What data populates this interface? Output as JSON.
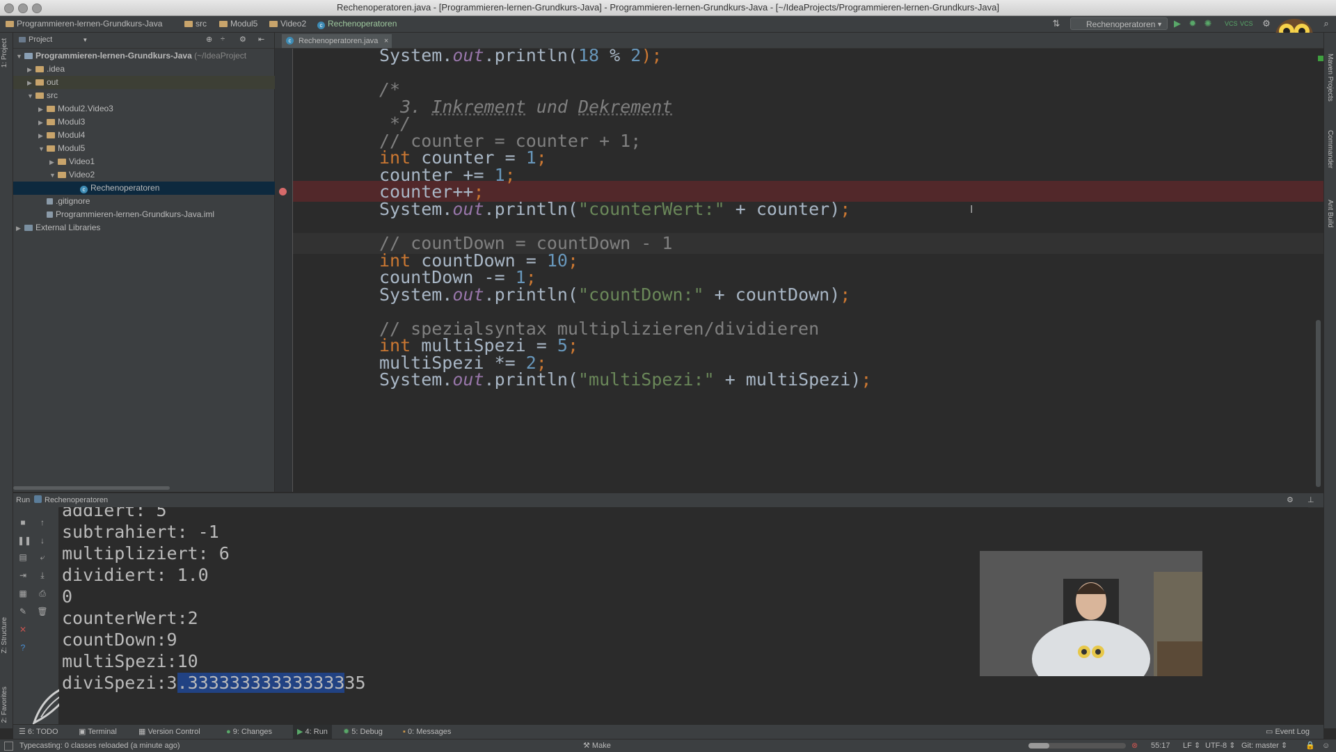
{
  "window": {
    "title": "Rechenoperatoren.java - [Programmieren-lernen-Grundkurs-Java] - Programmieren-lernen-Grundkurs-Java - [~/IdeaProjects/Programmieren-lernen-Grundkurs-Java]"
  },
  "breadcrumbs": [
    "Programmieren-lernen-Grundkurs-Java",
    "src",
    "Modul5",
    "Video2",
    "Rechenoperatoren"
  ],
  "run_config": {
    "selected": "Rechenoperatoren"
  },
  "project_panel": {
    "title": "Project",
    "tree": [
      {
        "label": "Programmieren-lernen-Grundkurs-Java",
        "suffix": "(~/IdeaProject",
        "depth": 0,
        "expanded": true,
        "kind": "module"
      },
      {
        "label": ".idea",
        "depth": 1,
        "expanded": false,
        "kind": "folder"
      },
      {
        "label": "out",
        "depth": 1,
        "expanded": false,
        "kind": "folder"
      },
      {
        "label": "src",
        "depth": 1,
        "expanded": true,
        "kind": "folder"
      },
      {
        "label": "Modul2.Video3",
        "depth": 2,
        "expanded": false,
        "kind": "folder"
      },
      {
        "label": "Modul3",
        "depth": 2,
        "expanded": false,
        "kind": "folder"
      },
      {
        "label": "Modul4",
        "depth": 2,
        "expanded": false,
        "kind": "folder"
      },
      {
        "label": "Modul5",
        "depth": 2,
        "expanded": true,
        "kind": "folder"
      },
      {
        "label": "Video1",
        "depth": 3,
        "expanded": false,
        "kind": "folder"
      },
      {
        "label": "Video2",
        "depth": 3,
        "expanded": true,
        "kind": "folder"
      },
      {
        "label": "Rechenoperatoren",
        "depth": 5,
        "kind": "class",
        "selected": true
      },
      {
        "label": ".gitignore",
        "depth": 2,
        "kind": "file"
      },
      {
        "label": "Programmieren-lernen-Grundkurs-Java.iml",
        "depth": 2,
        "kind": "file"
      },
      {
        "label": "External Libraries",
        "depth": 0,
        "expanded": false,
        "kind": "library"
      }
    ]
  },
  "editor": {
    "tab": "Rechenoperatoren.java",
    "lines": [
      [
        [
          "System.",
          ""
        ],
        [
          "out",
          "it"
        ],
        [
          ".println(",
          ""
        ],
        [
          "18",
          "num"
        ],
        [
          " % ",
          ""
        ],
        [
          "2",
          "num"
        ],
        [
          ");",
          "kw"
        ]
      ],
      [],
      [
        [
          "/*",
          "cmt"
        ]
      ],
      [
        [
          "  3. ",
          "cmt"
        ],
        [
          "Inkrement",
          "cmt-ul"
        ],
        [
          " und ",
          "cmt"
        ],
        [
          "Dekrement",
          "cmt-ul"
        ]
      ],
      [
        [
          " */",
          "cmt"
        ]
      ],
      [
        [
          "// counter = counter + 1;",
          "cmt"
        ]
      ],
      [
        [
          "int",
          "kw"
        ],
        [
          " counter = ",
          ""
        ],
        [
          "1",
          "num"
        ],
        [
          ";",
          "kw"
        ]
      ],
      [
        [
          "counter += ",
          ""
        ],
        [
          "1",
          "num"
        ],
        [
          ";",
          "kw"
        ]
      ],
      [
        [
          "counter++",
          ""
        ],
        [
          ";",
          "kw"
        ]
      ],
      [
        [
          "System.",
          ""
        ],
        [
          "out",
          "it"
        ],
        [
          ".println(",
          ""
        ],
        [
          "\"counterWert:\"",
          "str"
        ],
        [
          " + counter)",
          ""
        ],
        [
          ";",
          "kw"
        ]
      ],
      [],
      [
        [
          "// countDown = countDown - 1",
          "cmt"
        ]
      ],
      [
        [
          "int",
          "kw"
        ],
        [
          " countDown = ",
          ""
        ],
        [
          "10",
          "num"
        ],
        [
          ";",
          "kw"
        ]
      ],
      [
        [
          "countDown -= ",
          ""
        ],
        [
          "1",
          "num"
        ],
        [
          ";",
          "kw"
        ]
      ],
      [
        [
          "System.",
          ""
        ],
        [
          "out",
          "it"
        ],
        [
          ".println(",
          ""
        ],
        [
          "\"countDown:\"",
          "str"
        ],
        [
          " + countDown)",
          ""
        ],
        [
          ";",
          "kw"
        ]
      ],
      [],
      [
        [
          "// spezialsyntax multiplizieren/dividieren",
          "cmt"
        ]
      ],
      [
        [
          "int",
          "kw"
        ],
        [
          " multiSpezi = ",
          ""
        ],
        [
          "5",
          "num"
        ],
        [
          ";",
          "kw"
        ]
      ],
      [
        [
          "multiSpezi *= ",
          ""
        ],
        [
          "2",
          "num"
        ],
        [
          ";",
          "kw"
        ]
      ],
      [
        [
          "System.",
          ""
        ],
        [
          "out",
          "it"
        ],
        [
          ".println(",
          ""
        ],
        [
          "\"multiSpezi:\"",
          "str"
        ],
        [
          " + multiSpezi)",
          ""
        ],
        [
          ";",
          "kw"
        ]
      ]
    ]
  },
  "run_panel": {
    "label": "Run",
    "config": "Rechenoperatoren",
    "output": [
      "addiert: 5",
      "subtrahiert: -1",
      "multipliziert: 6",
      "dividiert: 1.0",
      "0",
      "counterWert:2",
      "countDown:9",
      "multiSpezi:10"
    ],
    "last_line_prefix": "diviSpezi:3",
    "last_line_selected": ".333333333333333",
    "last_line_suffix": "35"
  },
  "tool_windows": [
    {
      "label": "6: TODO"
    },
    {
      "label": "Terminal"
    },
    {
      "label": "Version Control"
    },
    {
      "label": "9: Changes"
    },
    {
      "label": "4: Run"
    },
    {
      "label": "5: Debug"
    },
    {
      "label": "0: Messages"
    }
  ],
  "event_log": "Event Log",
  "side_tabs": {
    "left": [
      "1: Project",
      "Z: Structure",
      "2: Favorites"
    ],
    "right": [
      "Maven Projects",
      "Commander",
      "Ant Build"
    ]
  },
  "status": {
    "message": "Typecasting: 0 classes reloaded (a minute ago)",
    "make": "Make",
    "position": "55:17",
    "line_sep": "LF",
    "encoding": "UTF-8",
    "vcs": "Git: master"
  },
  "colors": {
    "keyword": "#cc7832",
    "number": "#6897bb",
    "string": "#6a8759",
    "comment": "#808080",
    "breakpoint_line": "#52282a",
    "selection": "#214283"
  }
}
